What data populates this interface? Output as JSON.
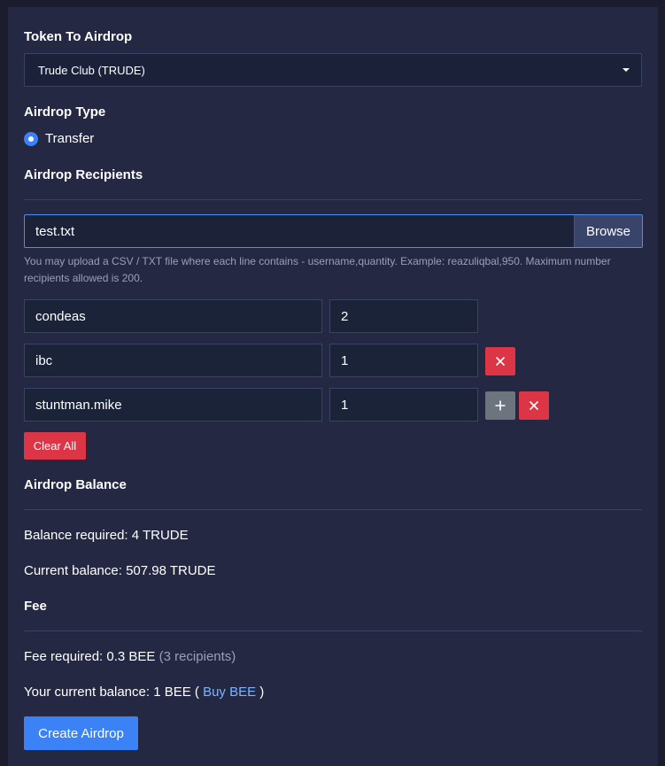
{
  "token_section": {
    "heading": "Token To Airdrop",
    "selected_token": "Trude Club (TRUDE)"
  },
  "airdrop_type": {
    "heading": "Airdrop Type",
    "option_label": "Transfer"
  },
  "recipients": {
    "heading": "Airdrop Recipients",
    "file_name": "test.txt",
    "browse_label": "Browse",
    "help_text": "You may upload a CSV / TXT file where each line contains - username,quantity. Example: reazuliqbal,950. Maximum number recipients allowed is 200.",
    "rows": [
      {
        "username": "condeas",
        "quantity": "2"
      },
      {
        "username": "ibc",
        "quantity": "1"
      },
      {
        "username": "stuntman.mike",
        "quantity": "1"
      }
    ],
    "clear_all_label": "Clear All"
  },
  "balance": {
    "heading": "Airdrop Balance",
    "required_text": "Balance required: 4 TRUDE",
    "current_text": "Current balance: 507.98 TRUDE"
  },
  "fee": {
    "heading": "Fee",
    "required_text": "Fee required: 0.3 BEE",
    "recipients_note": "(3 recipients)",
    "current_prefix": "Your current balance: 1 BEE (",
    "buy_link": "Buy BEE",
    "current_suffix": ")"
  },
  "create_button_label": "Create Airdrop",
  "icons": {
    "caret": "chevron-down-icon",
    "remove": "close-icon",
    "add": "plus-icon"
  },
  "colors": {
    "background": "#1b1d2e",
    "panel": "#242843",
    "accent": "#3b82f6",
    "danger": "#dc3545",
    "secondary": "#6c757d",
    "link": "#7cb4ff"
  }
}
